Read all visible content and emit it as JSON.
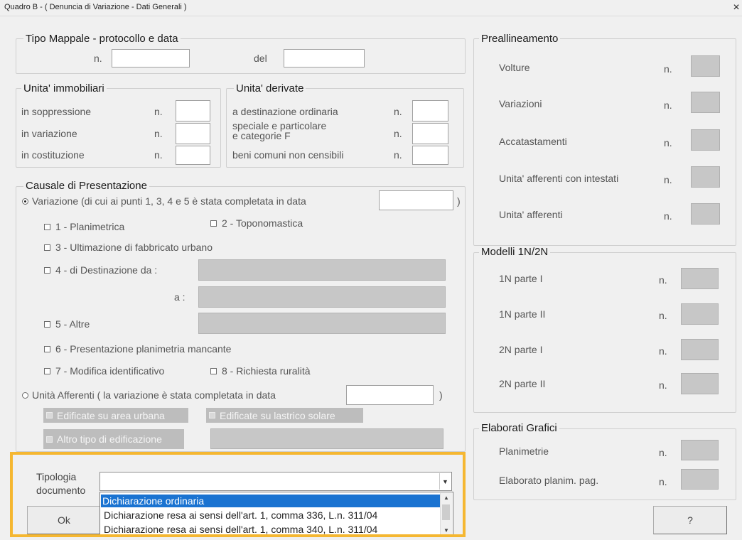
{
  "window": {
    "title": "Quadro B - ( Denuncia di Variazione - Dati Generali )",
    "close": "×"
  },
  "tipo_mappale": {
    "legend": "Tipo Mappale - protocollo e data",
    "n_label": "n.",
    "del_label": "del"
  },
  "unita_immobiliari": {
    "legend": "Unita' immobiliari",
    "rows": [
      {
        "label": "in soppressione",
        "n": "n."
      },
      {
        "label": "in variazione",
        "n": "n."
      },
      {
        "label": "in costituzione",
        "n": "n."
      }
    ]
  },
  "unita_derivate": {
    "legend": "Unita' derivate",
    "rows": [
      {
        "label": "a destinazione ordinaria",
        "n": "n."
      },
      {
        "label": "speciale e particolare\ne categorie F",
        "n": "n."
      },
      {
        "label": "beni comuni non censibili",
        "n": "n."
      }
    ]
  },
  "causale": {
    "legend": "Causale di Presentazione",
    "variazione_label": "Variazione (di cui ai punti 1, 3, 4 e 5 è stata completata in data",
    "variazione_close": ")",
    "cb1": "1 - Planimetrica",
    "cb2": "2 - Toponomastica",
    "cb3": "3 - Ultimazione di fabbricato urbano",
    "cb4": "4 - di Destinazione da :",
    "a_label": "a :",
    "cb5": "5 - Altre",
    "cb6": "6 - Presentazione planimetria mancante",
    "cb7": "7 - Modifica identificativo",
    "cb8": "8 - Richiesta ruralità",
    "unita_afferenti_label": "Unità Afferenti ( la variazione è stata completata in data",
    "unita_afferenti_close": ")",
    "ed_urbana": "Edificate su area urbana",
    "ed_lastrico": "Edificate su lastrico solare",
    "altro_tipo": "Altro tipo di edificazione"
  },
  "preallineamento": {
    "legend": "Preallineamento",
    "rows": [
      {
        "label": "Volture",
        "n": "n."
      },
      {
        "label": "Variazioni",
        "n": "n."
      },
      {
        "label": "Accatastamenti",
        "n": "n."
      },
      {
        "label": "Unita' afferenti con intestati",
        "n": "n."
      },
      {
        "label": "Unita' afferenti",
        "n": "n."
      }
    ]
  },
  "modelli": {
    "legend": "Modelli 1N/2N",
    "rows": [
      {
        "label": "1N parte I",
        "n": "n."
      },
      {
        "label": "1N parte II",
        "n": "n."
      },
      {
        "label": "2N parte I",
        "n": "n."
      },
      {
        "label": "2N parte II",
        "n": "n."
      }
    ]
  },
  "elaborati": {
    "legend": "Elaborati Grafici",
    "rows": [
      {
        "label": "Planimetrie",
        "n": "n."
      },
      {
        "label": "Elaborato planim. pag.",
        "n": "n."
      }
    ]
  },
  "tipologia": {
    "label_line1": "Tipologia",
    "label_line2": "documento",
    "value": "",
    "options": [
      "Dichiarazione ordinaria",
      "Dichiarazione resa ai sensi dell'art. 1, comma 336, L.n. 311/04",
      "Dichiarazione resa ai sensi dell'art. 1, comma 340, L.n. 311/04"
    ],
    "selected_index": 0
  },
  "buttons": {
    "ok": "Ok",
    "help": "?"
  },
  "colors": {
    "highlight": "#f5b731",
    "selection": "#1a73d1"
  }
}
